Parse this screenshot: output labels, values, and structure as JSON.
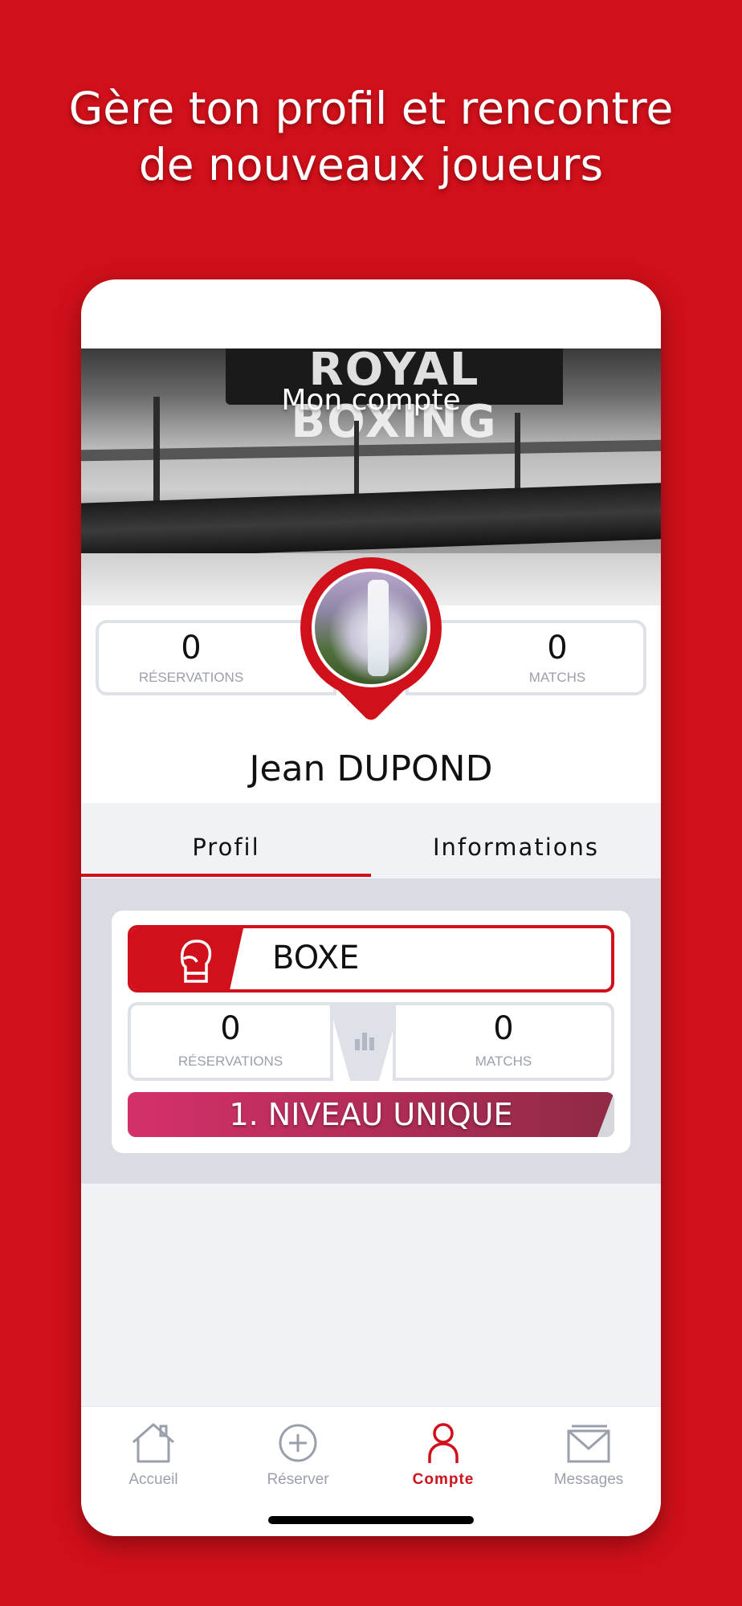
{
  "headline": {
    "line1": "Gère ton profil et rencontre",
    "line2": "de nouveaux joueurs"
  },
  "cover": {
    "title": "Mon compte",
    "banner_text": "ROYAL BOXING"
  },
  "profile": {
    "reservations_count": "0",
    "reservations_label": "RÉSERVATIONS",
    "matchs_count": "0",
    "matchs_label": "MATCHS",
    "first_name": "Jean",
    "last_name": "DUPOND"
  },
  "tabs": [
    {
      "label": "Profil",
      "active": true
    },
    {
      "label": "Informations",
      "active": false
    }
  ],
  "sport_card": {
    "icon": "boxing-glove-icon",
    "sport": "BOXE",
    "reservations_count": "0",
    "reservations_label": "RÉSERVATIONS",
    "matchs_count": "0",
    "matchs_label": "MATCHS",
    "stats_icon": "bar-chart-icon",
    "level_label": "1. NIVEAU UNIQUE"
  },
  "nav": [
    {
      "label": "Accueil",
      "icon": "home-icon",
      "active": false
    },
    {
      "label": "Réserver",
      "icon": "plus-circle-icon",
      "active": false
    },
    {
      "label": "Compte",
      "icon": "user-icon",
      "active": true
    },
    {
      "label": "Messages",
      "icon": "mail-icon",
      "active": false
    }
  ],
  "colors": {
    "brand_red": "#d0101a",
    "level_gradient_start": "#d4306a",
    "level_gradient_end": "#8f2a45",
    "muted": "#9aa0ab"
  }
}
